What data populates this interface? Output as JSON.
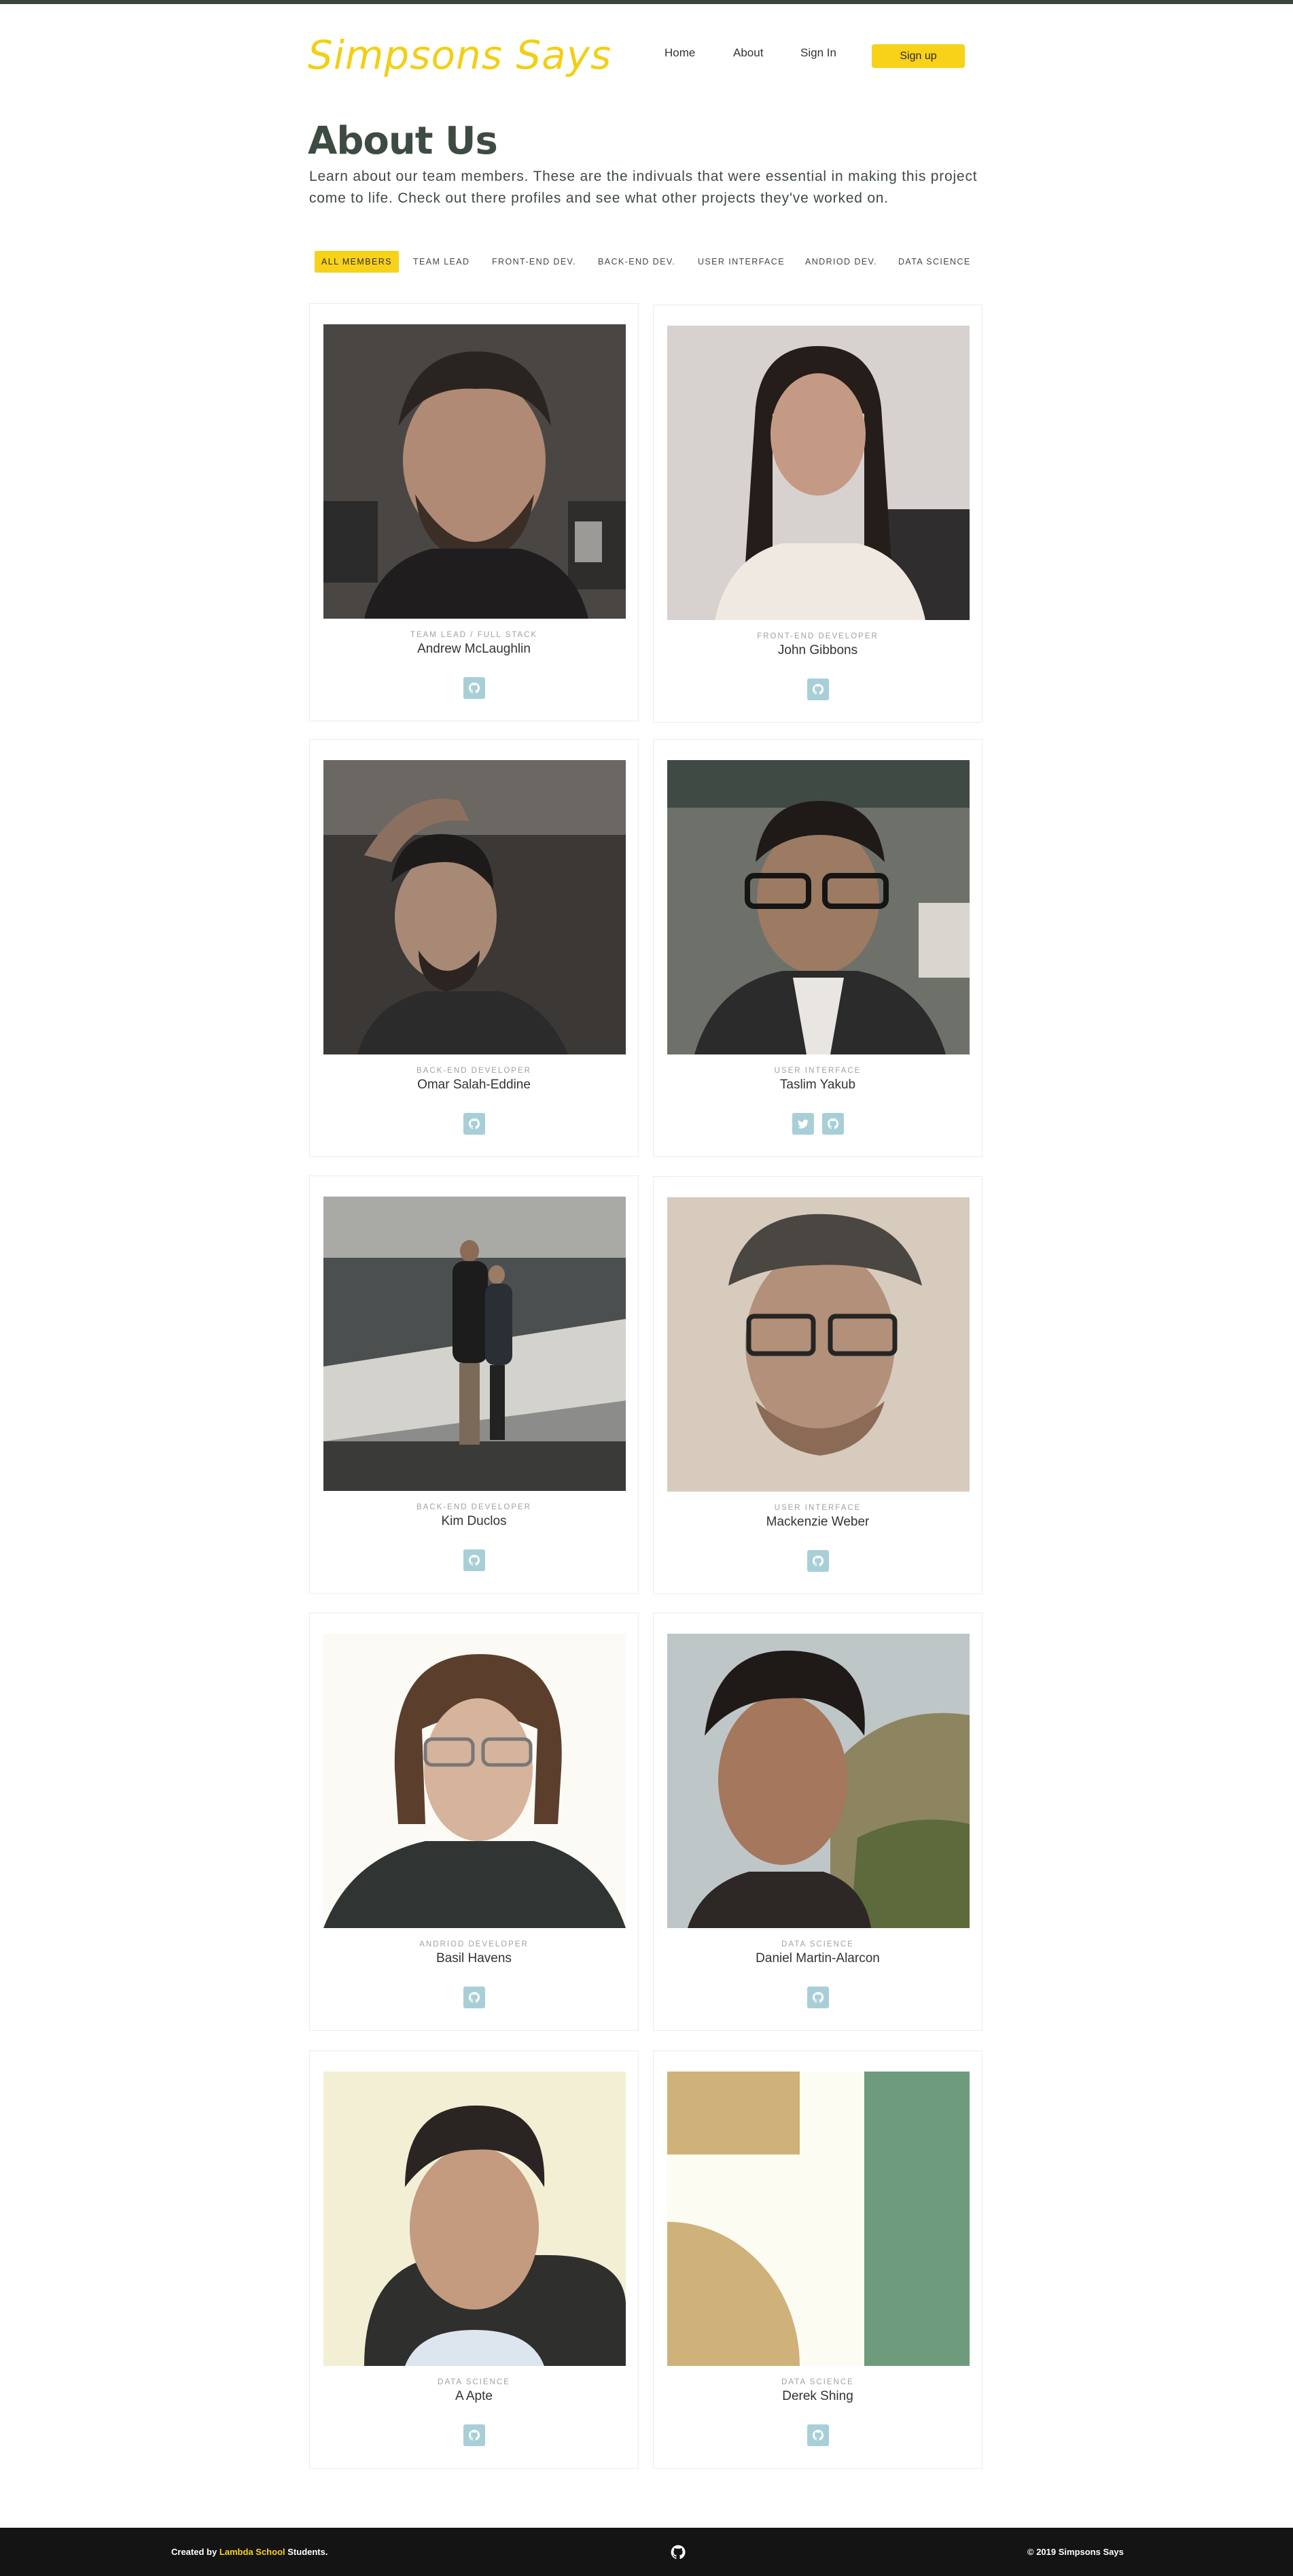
{
  "header": {
    "logo": "Simpsons Says",
    "nav": {
      "home": "Home",
      "about": "About",
      "sign_in": "Sign In",
      "sign_up": "Sign up"
    }
  },
  "page": {
    "title": "About Us",
    "intro": "Learn about our team members. These are the indivuals that were essential in making this project come to life. Check out there profiles and see what other projects they've worked on."
  },
  "filters": [
    "ALL MEMBERS",
    "TEAM LEAD",
    "FRONT-END DEV.",
    "BACK-END DEV.",
    "USER INTERFACE",
    "ANDRIOD DEV.",
    "DATA SCIENCE"
  ],
  "active_filter": "ALL MEMBERS",
  "members": [
    {
      "role": "Team Lead / Full Stack",
      "name": "Andrew McLaughlin",
      "socials": [
        "github-icon"
      ]
    },
    {
      "role": "Front-End Developer",
      "name": "John Gibbons",
      "socials": [
        "github-icon"
      ]
    },
    {
      "role": "Back-End Developer",
      "name": "Omar Salah-Eddine",
      "socials": [
        "github-icon"
      ]
    },
    {
      "role": "User Interface",
      "name": "Taslim Yakub",
      "socials": [
        "twitter-icon",
        "github-icon"
      ]
    },
    {
      "role": "Back-End Developer",
      "name": "Kim Duclos",
      "socials": [
        "github-icon"
      ]
    },
    {
      "role": "User Interface",
      "name": "Mackenzie Weber",
      "socials": [
        "github-icon"
      ]
    },
    {
      "role": "Andriod Developer",
      "name": "Basil Havens",
      "socials": [
        "github-icon"
      ]
    },
    {
      "role": "Data Science",
      "name": "Daniel Martin-Alarcon",
      "socials": [
        "github-icon"
      ]
    },
    {
      "role": "Data Science",
      "name": "A Apte",
      "socials": [
        "github-icon"
      ]
    },
    {
      "role": "Data Science",
      "name": "Derek Shing",
      "socials": [
        "github-icon"
      ]
    }
  ],
  "footer": {
    "created_prefix": "Created by",
    "created_link": "Lambda School",
    "created_suffix": "Students.",
    "copyright": "© 2019 Simpsons Says"
  },
  "colors": {
    "accent": "#f7d219",
    "heading": "#3d4b43",
    "social_bg": "#a8cfd8",
    "footer_bg": "#141414"
  }
}
